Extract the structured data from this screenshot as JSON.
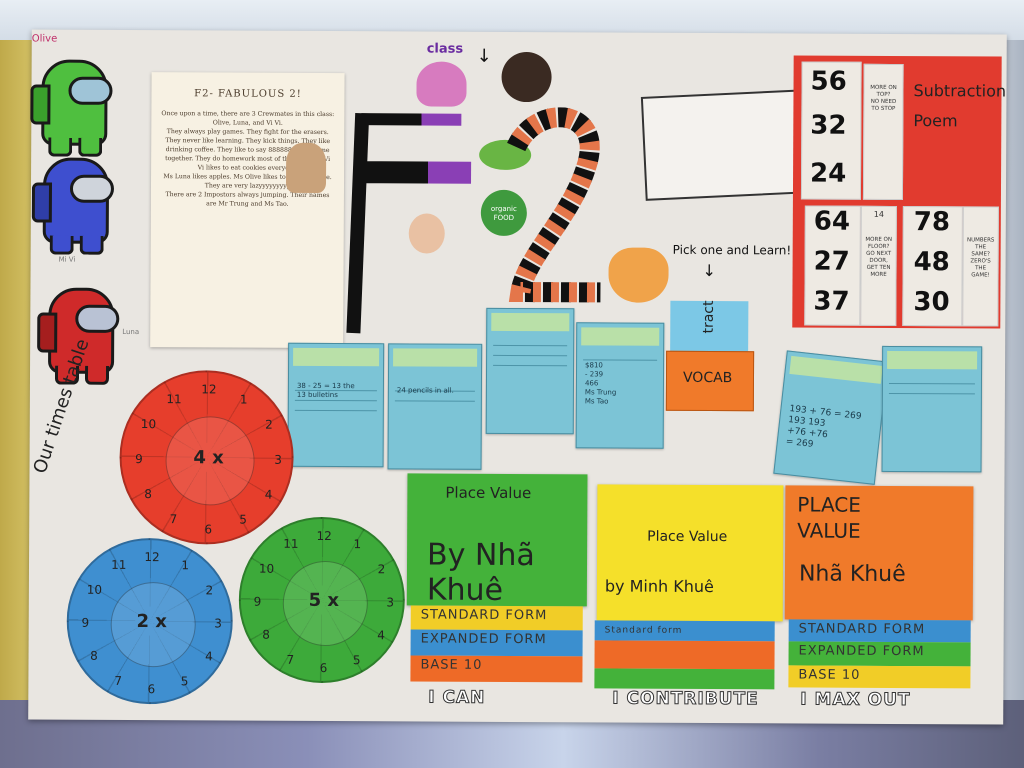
{
  "photo": {
    "poster_title_letters": "F2",
    "class_label": "class",
    "class_arrow": "↓",
    "story": {
      "title": "F2- FABULOUS 2!",
      "text": "Once upon a time, there are 3 Crewmates in this class: Olive, Luna, and Vi Vi.\nThey always play games. They fight for the erasers. They never like learning. They kick things. They like drinking coffee. They like to say 888888 all the time together. They do homework most of the time. Ms Vi Vi likes to eat cookies everyday.\nMs Luna likes apples. Ms Olive likes to eat chocolate. They are very lazyyyyyyyyy\nThere are 2 Impostors always jumping. Their names are Mr Trung and Ms Tao."
    },
    "organic_food_label": "organic FOOD",
    "pick_one": "Pick one and Learn!",
    "pick_arrow": "↓",
    "times_table_label": "Our times table",
    "wheels": [
      {
        "color": "#e63e2c",
        "center": "4 x",
        "numbers": [
          "12",
          "1",
          "2",
          "3",
          "4",
          "5",
          "6",
          "7",
          "8",
          "9",
          "10",
          "11"
        ]
      },
      {
        "color": "#3f8fd0",
        "center": "2 x",
        "numbers": [
          "12",
          "1",
          "2",
          "3",
          "4",
          "5",
          "6",
          "7",
          "8",
          "9",
          "10",
          "11"
        ]
      },
      {
        "color": "#3daa3a",
        "center": "5 x",
        "numbers": [
          "12",
          "1",
          "2",
          "3",
          "4",
          "5",
          "6",
          "7",
          "8",
          "9",
          "10",
          "11"
        ]
      }
    ],
    "cards": [
      {
        "text": "38 - 25 = 13 the\n13 bulletins"
      },
      {
        "text": "24 pencils in all."
      },
      {
        "text": ""
      },
      {
        "text": "  $810\n - 239\n   466\nMs Trung\nMs Tao"
      },
      {
        "text": ""
      },
      {
        "text": "193 + 76 = 269\n  193   193\n +76   +76\n  = 269"
      },
      {
        "text": ""
      }
    ],
    "vocab_pocket": {
      "card": "tract",
      "front": "VOCAB"
    },
    "subtraction": {
      "title": "Subtraction Poem",
      "col1": [
        "56",
        "32",
        "24"
      ],
      "col1_note": "MORE ON TOP?\nNO NEED TO STOP",
      "col2": [
        "64",
        "27",
        "37"
      ],
      "col2_badge": "14",
      "col2_note": "MORE ON FLOOR?\nGO NEXT DOOR,\nGET TEN MORE",
      "col3": [
        "78",
        "48",
        "30"
      ],
      "col3_note": "NUMBERS THE SAME?\nZERO'S THE GAME!"
    },
    "pv_green": {
      "title": "Place Value",
      "by": "By Nhã Khuê"
    },
    "pv_yellow": {
      "title": "Place Value",
      "by": "by  Minh Khuê"
    },
    "pv_orange": {
      "title": "PLACE VALUE",
      "by": "Nhã Khuê"
    },
    "strips_left": [
      "STANDARD FORM",
      "EXPANDED FORM",
      "BASE 10"
    ],
    "strips_right": [
      "STANDARD FORM",
      "EXPANDED FORM",
      "BASE 10"
    ],
    "strip_mid": "Standard form",
    "footer": [
      "I CAN",
      "I CONTRIBUTE",
      "I MAX OUT"
    ],
    "names": [
      "Olive",
      "Mi Vi",
      "Luna"
    ]
  }
}
